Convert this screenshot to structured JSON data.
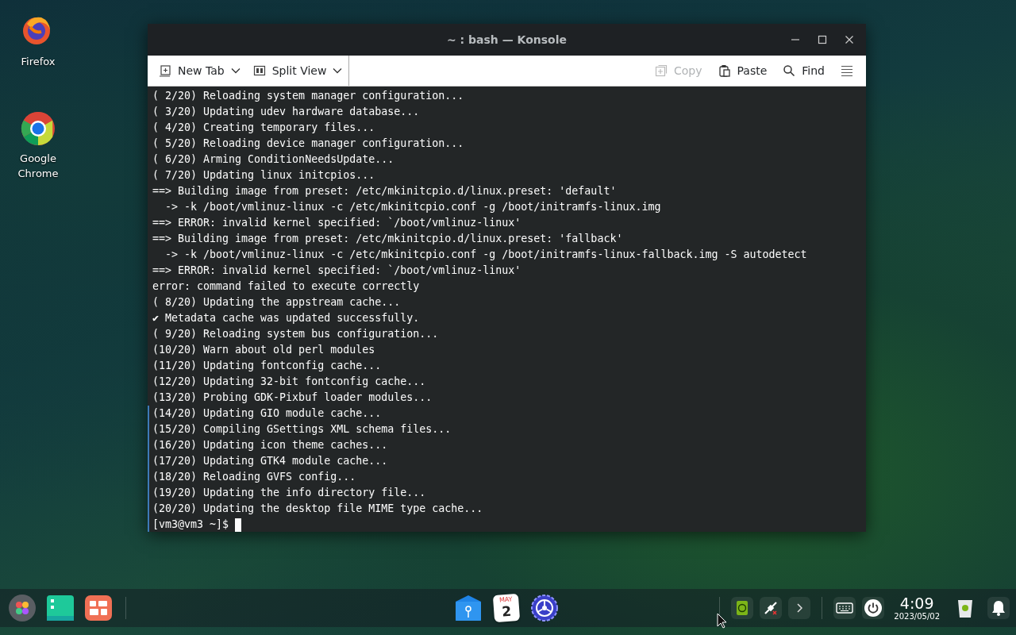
{
  "desktop_icons": [
    {
      "kind": "firefox",
      "label": "Firefox"
    },
    {
      "kind": "chrome",
      "label": "Google Chrome"
    }
  ],
  "window": {
    "title": "~ : bash — Konsole",
    "toolbar_left": [
      {
        "kind": "newtab",
        "label": "New Tab",
        "dropdown": true
      },
      {
        "kind": "split",
        "label": "Split View",
        "dropdown": true
      }
    ],
    "toolbar_right": [
      {
        "kind": "copy",
        "label": "Copy",
        "disabled": true
      },
      {
        "kind": "paste",
        "label": "Paste",
        "disabled": false
      },
      {
        "kind": "find",
        "label": "Find",
        "disabled": false
      }
    ],
    "terminal": {
      "lines": [
        {
          "text": "( 2/20) Reloading system manager configuration...",
          "marked": false
        },
        {
          "text": "( 3/20) Updating udev hardware database...",
          "marked": false
        },
        {
          "text": "( 4/20) Creating temporary files...",
          "marked": false
        },
        {
          "text": "( 5/20) Reloading device manager configuration...",
          "marked": false
        },
        {
          "text": "( 6/20) Arming ConditionNeedsUpdate...",
          "marked": false
        },
        {
          "text": "( 7/20) Updating linux initcpios...",
          "marked": false
        },
        {
          "text": "==> Building image from preset: /etc/mkinitcpio.d/linux.preset: 'default'",
          "marked": false
        },
        {
          "text": "  -> -k /boot/vmlinuz-linux -c /etc/mkinitcpio.conf -g /boot/initramfs-linux.img",
          "marked": false
        },
        {
          "text": "==> ERROR: invalid kernel specified: `/boot/vmlinuz-linux'",
          "marked": false
        },
        {
          "text": "==> Building image from preset: /etc/mkinitcpio.d/linux.preset: 'fallback'",
          "marked": false
        },
        {
          "text": "  -> -k /boot/vmlinuz-linux -c /etc/mkinitcpio.conf -g /boot/initramfs-linux-fallback.img -S autodetect",
          "marked": false
        },
        {
          "text": "==> ERROR: invalid kernel specified: `/boot/vmlinuz-linux'",
          "marked": false
        },
        {
          "text": "error: command failed to execute correctly",
          "marked": false
        },
        {
          "text": "( 8/20) Updating the appstream cache...",
          "marked": false
        },
        {
          "text": "✔ Metadata cache was updated successfully.",
          "marked": false
        },
        {
          "text": "( 9/20) Reloading system bus configuration...",
          "marked": false
        },
        {
          "text": "(10/20) Warn about old perl modules",
          "marked": false
        },
        {
          "text": "(11/20) Updating fontconfig cache...",
          "marked": false
        },
        {
          "text": "(12/20) Updating 32-bit fontconfig cache...",
          "marked": false
        },
        {
          "text": "(13/20) Probing GDK-Pixbuf loader modules...",
          "marked": false
        },
        {
          "text": "(14/20) Updating GIO module cache...",
          "marked": true
        },
        {
          "text": "(15/20) Compiling GSettings XML schema files...",
          "marked": true
        },
        {
          "text": "(16/20) Updating icon theme caches...",
          "marked": true
        },
        {
          "text": "(17/20) Updating GTK4 module cache...",
          "marked": true
        },
        {
          "text": "(18/20) Reloading GVFS config...",
          "marked": true
        },
        {
          "text": "(19/20) Updating the info directory file...",
          "marked": true
        },
        {
          "text": "(20/20) Updating the desktop file MIME type cache...",
          "marked": true
        }
      ],
      "prompt": {
        "text": "[vm3@vm3 ~]$",
        "marked": true
      }
    }
  },
  "taskbar": {
    "left": [
      {
        "kind": "launcher"
      },
      {
        "kind": "files"
      },
      {
        "kind": "apps"
      }
    ],
    "center": [
      {
        "kind": "mail"
      },
      {
        "kind": "calendar",
        "month": "MAY",
        "day": "2"
      },
      {
        "kind": "settings"
      }
    ],
    "tray": [
      {
        "kind": "update"
      },
      {
        "kind": "network"
      },
      {
        "kind": "expand"
      }
    ],
    "system": [
      {
        "kind": "keyboard"
      },
      {
        "kind": "power"
      }
    ],
    "clock": {
      "time": "4:09",
      "date": "2023/05/02"
    }
  }
}
